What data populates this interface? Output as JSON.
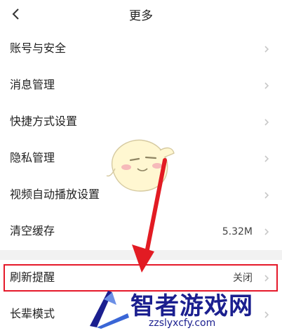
{
  "header": {
    "title": "更多"
  },
  "settings": {
    "items": [
      {
        "label": "账号与安全",
        "value": ""
      },
      {
        "label": "消息管理",
        "value": ""
      },
      {
        "label": "快捷方式设置",
        "value": ""
      },
      {
        "label": "隐私管理",
        "value": ""
      },
      {
        "label": "视频自动播放设置",
        "value": ""
      },
      {
        "label": "清空缓存",
        "value": "5.32M"
      }
    ],
    "items2": [
      {
        "label": "刷新提醒",
        "value": "关闭"
      },
      {
        "label": "长辈模式",
        "value": ""
      }
    ]
  },
  "watermark": {
    "brand": "智者游戏网",
    "url": "zzslyxcfy.com"
  },
  "colors": {
    "highlight": "#e5192a",
    "watermark": "#1b1f8f"
  },
  "icons": {
    "back": "chevron-left-icon",
    "row": "chevron-right-icon"
  }
}
